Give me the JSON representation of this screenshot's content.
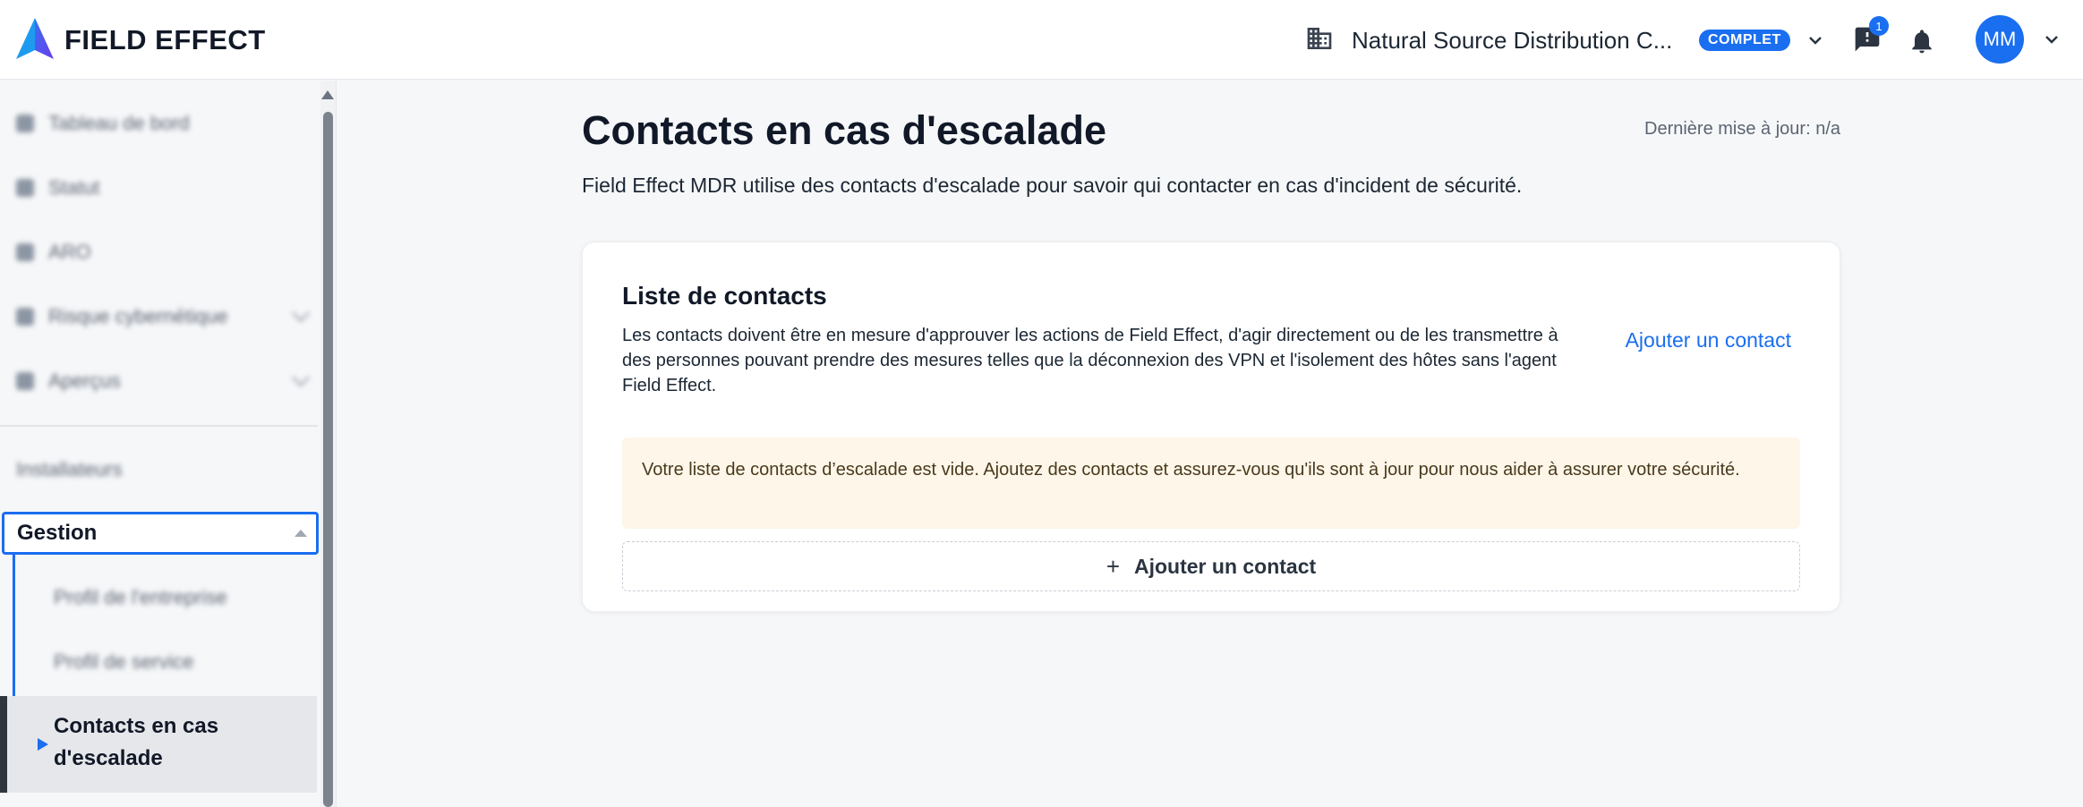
{
  "header": {
    "brand": "FIELD EFFECT",
    "organization": "Natural Source Distribution C...",
    "plan_badge": "COMPLET",
    "notifications_count": "1",
    "avatar_initials": "MM",
    "accent_color": "#1a6ef0"
  },
  "sidebar": {
    "items": [
      {
        "label": "Tableau de bord",
        "icon": "dashboard-icon"
      },
      {
        "label": "Statut",
        "icon": "status-icon"
      },
      {
        "label": "ARO",
        "icon": "aro-icon"
      },
      {
        "label": "Risque cybernétique",
        "icon": "risk-icon"
      },
      {
        "label": "Aperçus",
        "icon": "insights-icon"
      }
    ],
    "installers_label": "Installateurs",
    "gestion_label": "Gestion",
    "gestion_subitems": [
      "Profil de l'entreprise",
      "Profil de service"
    ],
    "active_label": "Contacts en cas d'escalade"
  },
  "main": {
    "title": "Contacts en cas d'escalade",
    "last_update": "Dernière mise à jour: n/a",
    "description": "Field Effect MDR utilise des contacts d'escalade pour savoir qui contacter en cas d'incident de sécurité.",
    "card": {
      "title": "Liste de contacts",
      "description": "Les contacts doivent être en mesure d'approuver les actions de Field Effect, d'agir directement ou de les transmettre à des personnes pouvant prendre des mesures telles que la déconnexion des VPN et l'isolement des hôtes sans l'agent Field Effect.",
      "add_link": "Ajouter un contact",
      "alert": "Votre liste de contacts d’escalade est vide. Ajoutez des contacts et assurez-vous qu'ils sont à jour pour nous aider à assurer votre sécurité.",
      "add_button_icon": "+",
      "add_button": "Ajouter un contact"
    }
  }
}
